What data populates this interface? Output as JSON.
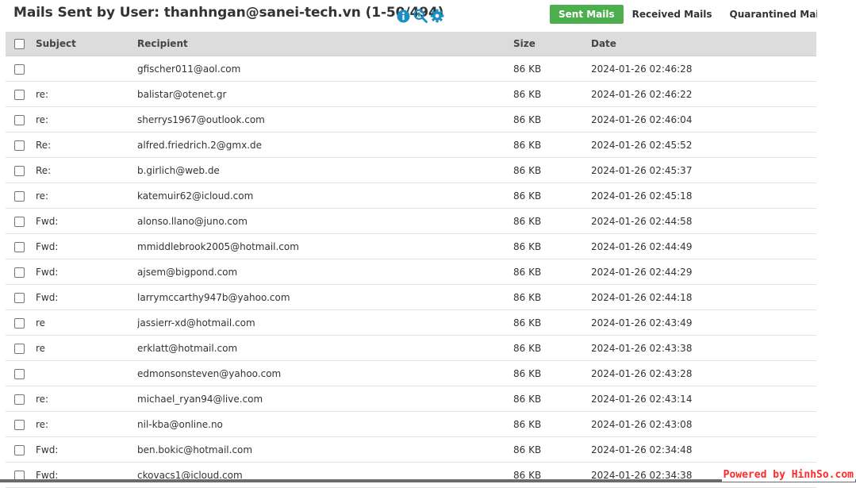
{
  "header": {
    "title": "Mails Sent by User: thanhngan@sanei-tech.vn (1-50/494)",
    "icons": [
      "info-icon",
      "zoom-in-icon",
      "gear-icon"
    ]
  },
  "tabs": [
    {
      "label": "Sent Mails",
      "active": true
    },
    {
      "label": "Received Mails",
      "active": false
    },
    {
      "label": "Quarantined Mails",
      "active": false
    }
  ],
  "table": {
    "columns": [
      "Subject",
      "Recipient",
      "Size",
      "Date"
    ],
    "rows": [
      {
        "subject": "",
        "recipient": "gfischer011@aol.com",
        "size": "86 KB",
        "date": "2024-01-26 02:46:28"
      },
      {
        "subject": "re:",
        "recipient": "balistar@otenet.gr",
        "size": "86 KB",
        "date": "2024-01-26 02:46:22"
      },
      {
        "subject": "re:",
        "recipient": "sherrys1967@outlook.com",
        "size": "86 KB",
        "date": "2024-01-26 02:46:04"
      },
      {
        "subject": "Re:",
        "recipient": "alfred.friedrich.2@gmx.de",
        "size": "86 KB",
        "date": "2024-01-26 02:45:52"
      },
      {
        "subject": "Re:",
        "recipient": "b.girlich@web.de",
        "size": "86 KB",
        "date": "2024-01-26 02:45:37"
      },
      {
        "subject": "re:",
        "recipient": "katemuir62@icloud.com",
        "size": "86 KB",
        "date": "2024-01-26 02:45:18"
      },
      {
        "subject": "Fwd:",
        "recipient": "alonso.llano@juno.com",
        "size": "86 KB",
        "date": "2024-01-26 02:44:58"
      },
      {
        "subject": "Fwd:",
        "recipient": "mmiddlebrook2005@hotmail.com",
        "size": "86 KB",
        "date": "2024-01-26 02:44:49"
      },
      {
        "subject": "Fwd:",
        "recipient": "ajsem@bigpond.com",
        "size": "86 KB",
        "date": "2024-01-26 02:44:29"
      },
      {
        "subject": "Fwd:",
        "recipient": "larrymccarthy947b@yahoo.com",
        "size": "86 KB",
        "date": "2024-01-26 02:44:18"
      },
      {
        "subject": "re",
        "recipient": "jassierr-xd@hotmail.com",
        "size": "86 KB",
        "date": "2024-01-26 02:43:49"
      },
      {
        "subject": "re",
        "recipient": "erklatt@hotmail.com",
        "size": "86 KB",
        "date": "2024-01-26 02:43:38"
      },
      {
        "subject": "",
        "recipient": "edmonsonsteven@yahoo.com",
        "size": "86 KB",
        "date": "2024-01-26 02:43:28"
      },
      {
        "subject": "re:",
        "recipient": "michael_ryan94@live.com",
        "size": "86 KB",
        "date": "2024-01-26 02:43:14"
      },
      {
        "subject": "re:",
        "recipient": "nil-kba@online.no",
        "size": "86 KB",
        "date": "2024-01-26 02:43:08"
      },
      {
        "subject": "Fwd:",
        "recipient": "ben.bokic@hotmail.com",
        "size": "86 KB",
        "date": "2024-01-26 02:34:48"
      },
      {
        "subject": "Fwd:",
        "recipient": "ckovacs1@icloud.com",
        "size": "86 KB",
        "date": "2024-01-26 02:34:38"
      }
    ]
  },
  "watermark": "Powered by HinhSo.com",
  "colors": {
    "accent_green": "#4cae4c",
    "icon_blue": "#1a8fc4",
    "header_bg": "#dcdcdc",
    "watermark_red": "#ff2a2a"
  }
}
